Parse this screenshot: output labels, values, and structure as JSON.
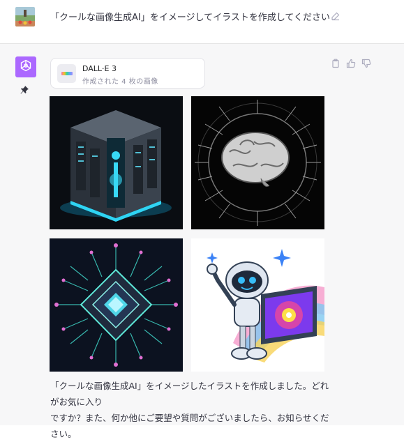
{
  "user": {
    "prompt": "「クールな画像生成AI」をイメージしてイラストを作成してください"
  },
  "tool": {
    "name": "DALL·E 3",
    "status": "作成された 4 枚の画像"
  },
  "images": [
    {
      "subject": "server-cube"
    },
    {
      "subject": "circuit-brain"
    },
    {
      "subject": "chip-circuit"
    },
    {
      "subject": "robot-mascot"
    }
  ],
  "reply": {
    "line1": "「クールな画像生成AI」をイメージしたイラストを作成しました。どれがお気に入り",
    "line2": "ですか？また、何か他にご要望や質問がございましたら、お知らせください。"
  },
  "colors": {
    "assistant_avatar": "#ab68ff",
    "assistant_bg": "#f7f7f8"
  },
  "icons": [
    "edit-icon",
    "openai-icon",
    "pin-icon",
    "copy-icon",
    "thumbs-up-icon",
    "thumbs-down-icon"
  ]
}
